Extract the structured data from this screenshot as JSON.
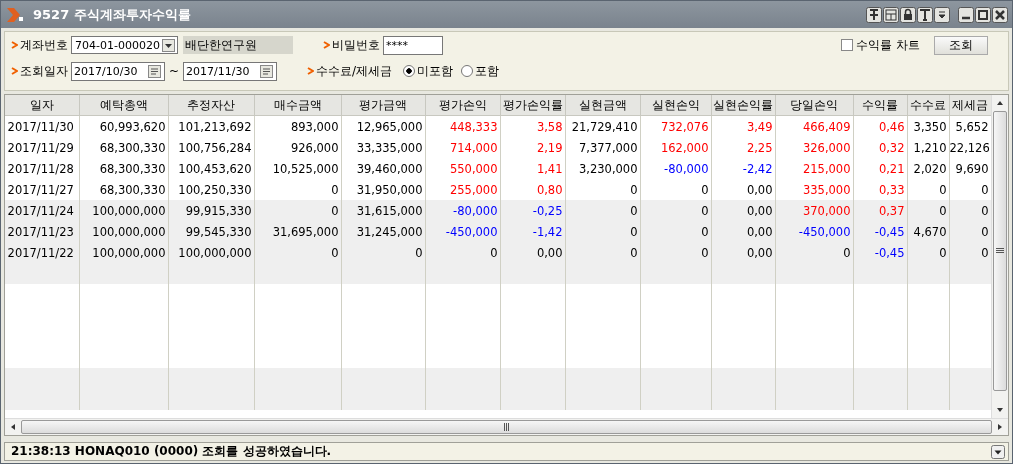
{
  "window": {
    "title": "9527 주식계좌투자수익률"
  },
  "form": {
    "account": {
      "label": "계좌번호",
      "value": "704-01-000020",
      "holder": "배단한연구원"
    },
    "password": {
      "label": "비밀번호",
      "value": "****"
    },
    "chart_checkbox": {
      "label": "수익률 차트",
      "checked": false
    },
    "search_button": "조회",
    "date": {
      "label": "조회일자",
      "from": "2017/10/30",
      "separator": "~",
      "to": "2017/11/30"
    },
    "fee": {
      "label": "수수료/제세금",
      "options": [
        {
          "label": "미포함",
          "selected": true
        },
        {
          "label": "포함",
          "selected": false
        }
      ]
    }
  },
  "table": {
    "columns": [
      "일자",
      "예탁총액",
      "추정자산",
      "매수금액",
      "평가금액",
      "평가손익",
      "평가손익률",
      "실현금액",
      "실현손익",
      "실현손익률",
      "당일손익",
      "수익률",
      "수수료",
      "제세금"
    ],
    "rows": [
      {
        "cells": [
          {
            "text": "2017/11/30"
          },
          {
            "text": "60,993,620"
          },
          {
            "text": "101,213,692"
          },
          {
            "text": "893,000"
          },
          {
            "text": "12,965,000"
          },
          {
            "text": "448,333",
            "color": "#ff0000"
          },
          {
            "text": "3,58",
            "color": "#ff0000"
          },
          {
            "text": "21,729,410"
          },
          {
            "text": "732,076",
            "color": "#ff0000"
          },
          {
            "text": "3,49",
            "color": "#ff0000"
          },
          {
            "text": "466,409",
            "color": "#ff0000"
          },
          {
            "text": "0,46",
            "color": "#ff0000"
          },
          {
            "text": "3,350"
          },
          {
            "text": "5,652"
          }
        ]
      },
      {
        "cells": [
          {
            "text": "2017/11/29"
          },
          {
            "text": "68,300,330"
          },
          {
            "text": "100,756,284"
          },
          {
            "text": "926,000"
          },
          {
            "text": "33,335,000"
          },
          {
            "text": "714,000",
            "color": "#ff0000"
          },
          {
            "text": "2,19",
            "color": "#ff0000"
          },
          {
            "text": "7,377,000"
          },
          {
            "text": "162,000",
            "color": "#ff0000"
          },
          {
            "text": "2,25",
            "color": "#ff0000"
          },
          {
            "text": "326,000",
            "color": "#ff0000"
          },
          {
            "text": "0,32",
            "color": "#ff0000"
          },
          {
            "text": "1,210"
          },
          {
            "text": "22,126"
          }
        ]
      },
      {
        "cells": [
          {
            "text": "2017/11/28"
          },
          {
            "text": "68,300,330"
          },
          {
            "text": "100,453,620"
          },
          {
            "text": "10,525,000"
          },
          {
            "text": "39,460,000"
          },
          {
            "text": "550,000",
            "color": "#ff0000"
          },
          {
            "text": "1,41",
            "color": "#ff0000"
          },
          {
            "text": "3,230,000"
          },
          {
            "text": "-80,000",
            "color": "#0000ff"
          },
          {
            "text": "-2,42",
            "color": "#0000ff"
          },
          {
            "text": "215,000",
            "color": "#ff0000"
          },
          {
            "text": "0,21",
            "color": "#ff0000"
          },
          {
            "text": "2,020"
          },
          {
            "text": "9,690"
          }
        ]
      },
      {
        "cells": [
          {
            "text": "2017/11/27"
          },
          {
            "text": "68,300,330"
          },
          {
            "text": "100,250,330"
          },
          {
            "text": "0"
          },
          {
            "text": "31,950,000"
          },
          {
            "text": "255,000",
            "color": "#ff0000"
          },
          {
            "text": "0,80",
            "color": "#ff0000"
          },
          {
            "text": "0"
          },
          {
            "text": "0"
          },
          {
            "text": "0,00"
          },
          {
            "text": "335,000",
            "color": "#ff0000"
          },
          {
            "text": "0,33",
            "color": "#ff0000"
          },
          {
            "text": "0"
          },
          {
            "text": "0"
          }
        ]
      },
      {
        "cells": [
          {
            "text": "2017/11/24"
          },
          {
            "text": "100,000,000"
          },
          {
            "text": "99,915,330"
          },
          {
            "text": "0"
          },
          {
            "text": "31,615,000"
          },
          {
            "text": "-80,000",
            "color": "#0000ff"
          },
          {
            "text": "-0,25",
            "color": "#0000ff"
          },
          {
            "text": "0"
          },
          {
            "text": "0"
          },
          {
            "text": "0,00"
          },
          {
            "text": "370,000",
            "color": "#ff0000"
          },
          {
            "text": "0,37",
            "color": "#ff0000"
          },
          {
            "text": "0"
          },
          {
            "text": "0"
          }
        ]
      },
      {
        "cells": [
          {
            "text": "2017/11/23"
          },
          {
            "text": "100,000,000"
          },
          {
            "text": "99,545,330"
          },
          {
            "text": "31,695,000"
          },
          {
            "text": "31,245,000"
          },
          {
            "text": "-450,000",
            "color": "#0000ff"
          },
          {
            "text": "-1,42",
            "color": "#0000ff"
          },
          {
            "text": "0"
          },
          {
            "text": "0"
          },
          {
            "text": "0,00"
          },
          {
            "text": "-450,000",
            "color": "#0000ff"
          },
          {
            "text": "-0,45",
            "color": "#0000ff"
          },
          {
            "text": "4,670"
          },
          {
            "text": "0"
          }
        ]
      },
      {
        "cells": [
          {
            "text": "2017/11/22"
          },
          {
            "text": "100,000,000"
          },
          {
            "text": "100,000,000"
          },
          {
            "text": "0"
          },
          {
            "text": "0"
          },
          {
            "text": "0"
          },
          {
            "text": "0,00"
          },
          {
            "text": "0"
          },
          {
            "text": "0"
          },
          {
            "text": "0,00"
          },
          {
            "text": "0"
          },
          {
            "text": "-0,45",
            "color": "#0000ff"
          },
          {
            "text": "0"
          },
          {
            "text": "0"
          }
        ]
      }
    ]
  },
  "status_bar": {
    "message": "21:38:13 HONAQ010 (0000) 조회를 성공하였습니다."
  }
}
